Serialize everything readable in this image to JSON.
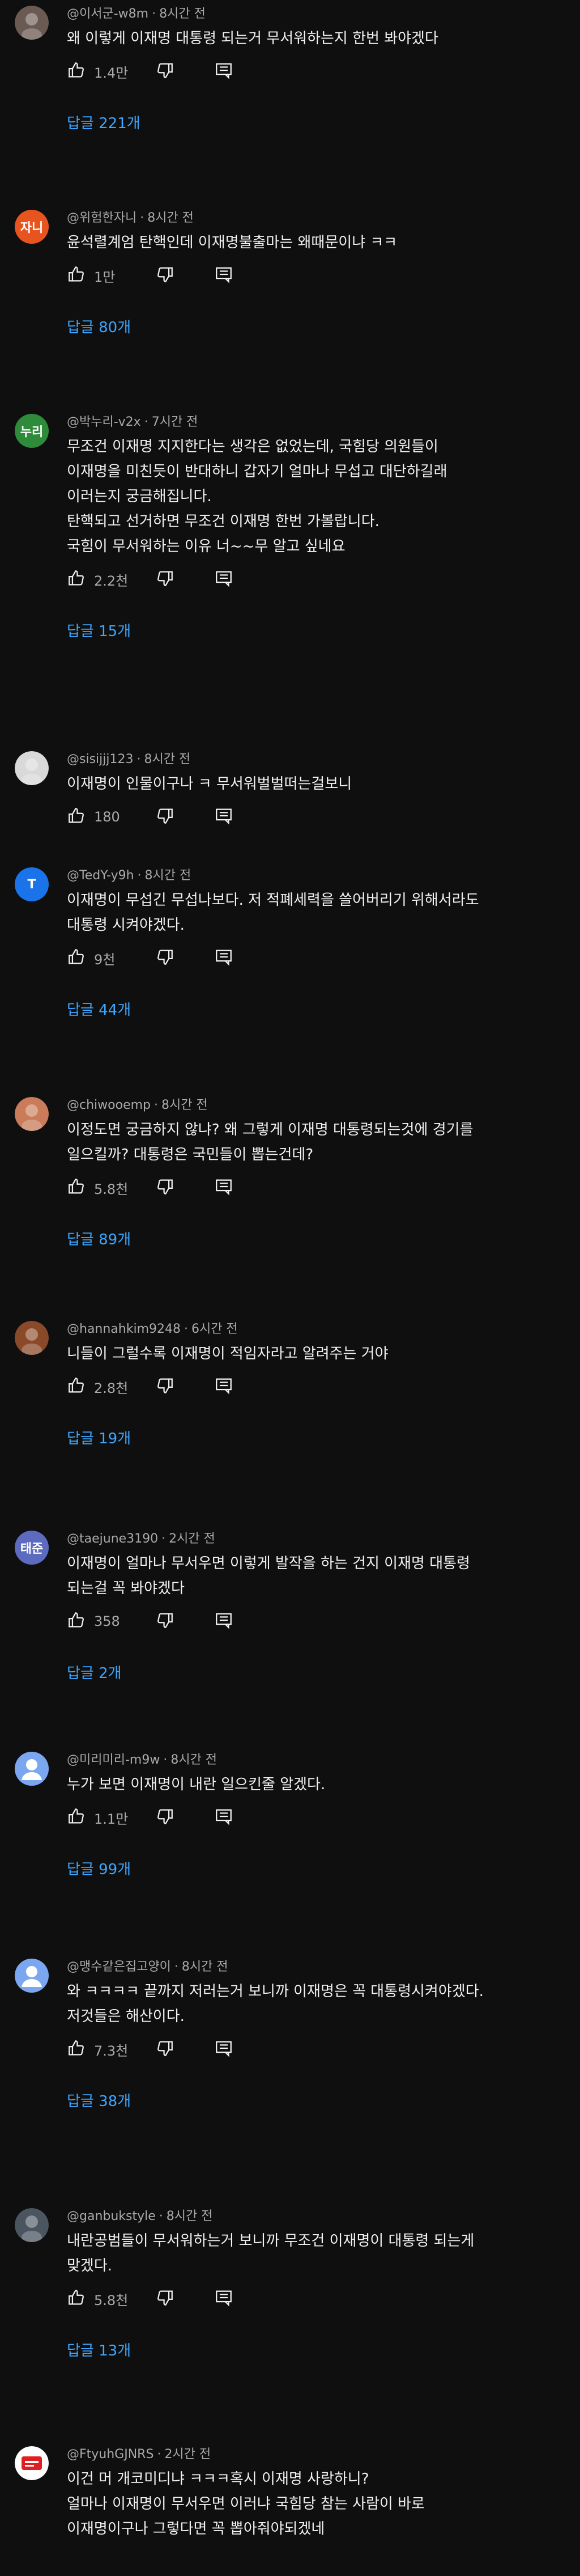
{
  "accent_link_color": "#3ea6ff",
  "comments": [
    {
      "author": "@이서군-w8m",
      "time": "8시간 전",
      "text": "왜 이렇게 이재명 대통령 되는거 무서워하는지 한번 봐야겠다",
      "likes": "1.4만",
      "replies": "답글 221개",
      "avatar": {
        "type": "image",
        "color": "#6b5a52",
        "initial": ""
      }
    },
    {
      "author": "@위험한자니",
      "time": "8시간 전",
      "text": "윤석렬계엄 탄핵인데 이재명불출마는 왜때문이냐 ㅋㅋ",
      "likes": "1만",
      "replies": "답글 80개",
      "avatar": {
        "type": "letter",
        "color": "#e8541f",
        "initial": "자니"
      }
    },
    {
      "author": "@박누리-v2x",
      "time": "7시간 전",
      "text": "무조건 이재명 지지한다는 생각은 없었는데, 국힘당 의원들이\n이재명을 미친듯이 반대하니 갑자기 얼마나 무섭고 대단하길래\n이러는지 궁금해집니다.\n탄핵되고 선거하면 무조건 이재명 한번 가볼랍니다.\n국힘이 무서워하는 이유 너~~무 알고 싶네요",
      "likes": "2.2천",
      "replies": "답글 15개",
      "avatar": {
        "type": "letter",
        "color": "#2e8b3a",
        "initial": "누리"
      }
    },
    {
      "author": "@sisijjj123",
      "time": "8시간 전",
      "text": "이재명이 인물이구나 ㅋ 무서워벌벌떠는걸보니",
      "likes": "180",
      "replies": "",
      "avatar": {
        "type": "image",
        "color": "#d9d9d9",
        "initial": ""
      }
    },
    {
      "author": "@TedY-y9h",
      "time": "8시간 전",
      "text": "이재명이 무섭긴 무섭나보다. 저 적폐세력을 쓸어버리기 위해서라도\n대통령 시켜야겠다.",
      "likes": "9천",
      "replies": "답글 44개",
      "avatar": {
        "type": "letter",
        "color": "#1a73e8",
        "initial": "T"
      }
    },
    {
      "author": "@chiwooemp",
      "time": "8시간 전",
      "text": "이정도면 궁금하지 않냐? 왜 그렇게 이재명 대통령되는것에 경기를\n일으킬까? 대통령은 국민들이 뽑는건데?",
      "likes": "5.8천",
      "replies": "답글 89개",
      "avatar": {
        "type": "image",
        "color": "#c97b5a",
        "initial": ""
      }
    },
    {
      "author": "@hannahkim9248",
      "time": "6시간 전",
      "text": "니들이 그럴수록 이재명이 적임자라고 알려주는 거야",
      "likes": "2.8천",
      "replies": "답글 19개",
      "avatar": {
        "type": "image",
        "color": "#8a4a2a",
        "initial": ""
      }
    },
    {
      "author": "@taejune3190",
      "time": "2시간 전",
      "text": "이재명이 얼마나 무서우면 이렇게 발작을 하는 건지 이재명 대통령\n되는걸 꼭 봐야겠다",
      "likes": "358",
      "replies": "답글 2개",
      "avatar": {
        "type": "letter",
        "color": "#5c6bc0",
        "initial": "태준"
      }
    },
    {
      "author": "@미리미리-m9w",
      "time": "8시간 전",
      "text": "누가 보면 이재명이 내란 일으킨줄 알겠다.",
      "likes": "1.1만",
      "replies": "답글 99개",
      "avatar": {
        "type": "person",
        "color": "#7aa7f0",
        "initial": ""
      }
    },
    {
      "author": "@맹수같은집고양이",
      "time": "8시간 전",
      "text": "와 ㅋㅋㅋㅋ 끝까지 저러는거 보니까 이재명은 꼭 대통령시켜야겠다.\n저것들은 해산이다.",
      "likes": "7.3천",
      "replies": "답글 38개",
      "avatar": {
        "type": "person",
        "color": "#7aa7f0",
        "initial": ""
      }
    },
    {
      "author": "@ganbukstyle",
      "time": "8시간 전",
      "text": "내란공범들이 무서워하는거 보니까 무조건 이재명이 대통령 되는게\n맞겠다.",
      "likes": "5.8천",
      "replies": "답글 13개",
      "avatar": {
        "type": "image",
        "color": "#4a5560",
        "initial": ""
      }
    },
    {
      "author": "@FtyuhGJNRS",
      "time": "2시간 전",
      "text": "이건 머 개코미디냐 ㅋㅋㅋ혹시 이재명 사랑하니?\n얼마나 이재명이 무서우면 이러냐 국힘당 참는 사람이 바로\n이재명이구나 그렇다면 꼭 뽑아줘야되겠네",
      "likes": "",
      "replies": "",
      "avatar": {
        "type": "badge",
        "color": "#ffffff",
        "initial": ""
      }
    }
  ]
}
